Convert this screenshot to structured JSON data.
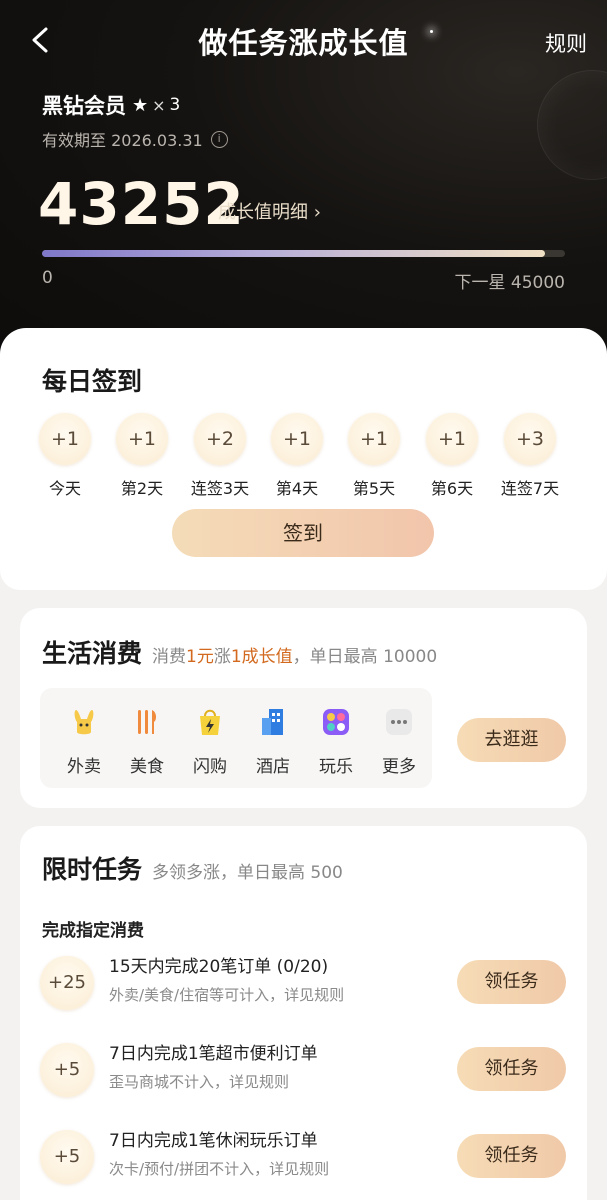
{
  "header": {
    "title": "做任务涨成长值",
    "rules_label": "规则"
  },
  "member": {
    "name": "黑钻会员",
    "star_symbol": "★",
    "times_symbol": "×",
    "level": "3",
    "validity": "有效期至 2026.03.31",
    "info_symbol": "i"
  },
  "growth": {
    "value": "43252",
    "detail_label": "成长值明细 ›",
    "progress_start": "0",
    "progress_end": "下一星 45000",
    "progress_fraction": 0.961
  },
  "daily_checkin": {
    "title": "每日签到",
    "days": [
      {
        "reward": "+1",
        "label": "今天"
      },
      {
        "reward": "+1",
        "label": "第2天"
      },
      {
        "reward": "+2",
        "label": "连签3天"
      },
      {
        "reward": "+1",
        "label": "第4天"
      },
      {
        "reward": "+1",
        "label": "第5天"
      },
      {
        "reward": "+1",
        "label": "第6天"
      },
      {
        "reward": "+3",
        "label": "连签7天"
      }
    ],
    "button_label": "签到"
  },
  "life_spending": {
    "title": "生活消费",
    "sub_prefix": "消费",
    "sub_amount": "1元",
    "sub_mid": "涨",
    "sub_gain": "1成长值",
    "sub_suffix": "，单日最高 10000",
    "categories": [
      {
        "label": "外卖",
        "icon": "rabbit-icon"
      },
      {
        "label": "美食",
        "icon": "utensils-icon"
      },
      {
        "label": "闪购",
        "icon": "lightning-bag-icon"
      },
      {
        "label": "酒店",
        "icon": "building-icon"
      },
      {
        "label": "玩乐",
        "icon": "fun-grid-icon"
      },
      {
        "label": "更多",
        "icon": "more-icon"
      }
    ],
    "button_label": "去逛逛"
  },
  "limited_tasks": {
    "title": "限时任务",
    "subtitle": "多领多涨，单日最高 500",
    "section_label": "完成指定消费",
    "tasks": [
      {
        "reward": "+25",
        "name": "15天内完成20笔订单 (0/20)",
        "desc": "外卖/美食/住宿等可计入，详见规则",
        "button": "领任务"
      },
      {
        "reward": "+5",
        "name": "7日内完成1笔超市便利订单",
        "desc": "歪马商城不计入，详见规则",
        "button": "领任务"
      },
      {
        "reward": "+5",
        "name": "7日内完成1笔休闲玩乐订单",
        "desc": "次卡/预付/拼团不计入，详见规则",
        "button": "领任务"
      }
    ]
  },
  "colors": {
    "accent": "#d2691e",
    "button_gradient_start": "#f6dcb6",
    "button_gradient_end": "#f0c9a8"
  }
}
